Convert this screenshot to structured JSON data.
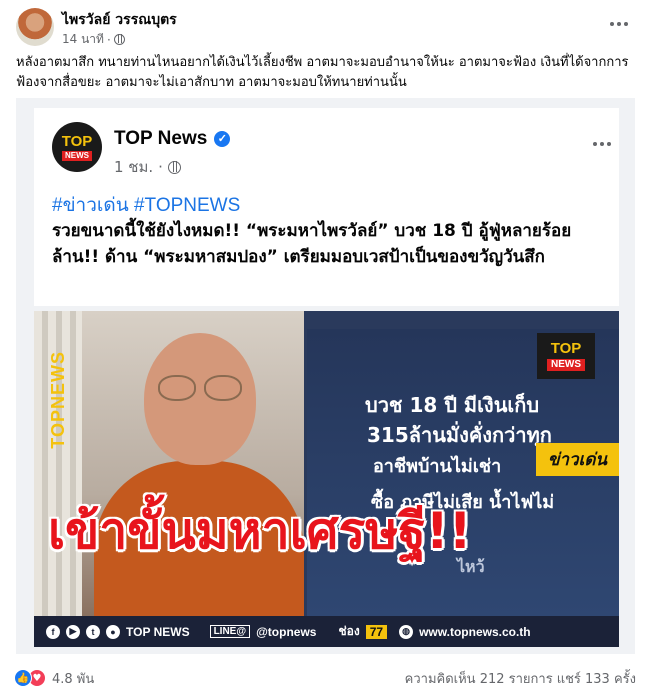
{
  "post": {
    "author": "ไพรวัลย์ วรรณบุตร",
    "time": "14 นาที",
    "dot": "·",
    "caption": "หลังอาตมาสึก ทนายท่านไหนอยากได้เงินไว้เลี้ยงชีพ อาตมาจะมอบอำนาจให้นะ อาตมาจะฟ้อง เงินที่ได้จากการฟ้องจากสื่อขยะ อาตมาจะไม่เอาสักบาท อาตมาจะมอบให้ทนายท่านนั้น"
  },
  "shared": {
    "page_name": "TOP News",
    "logo_top": "TOP",
    "logo_news": "NEWS",
    "time": "1 ชม.",
    "dot": "·",
    "tags": "#ข่าวเด่น #TOPNEWS",
    "text": "รวยขนาดนี้ใช้ยังไงหมด!! “พระมหาไพรวัลย์” บวช 18 ปี อู้ฟู่หลายร้อยล้าน!! ด้าน “พระมหาสมปอง” เตรียมมอบเวสป้าเป็นของขวัญวันสึก"
  },
  "graphic": {
    "vertical_brand": "TOPNEWS",
    "logo_top": "TOP",
    "logo_news": "NEWS",
    "line1": "บวช 18 ปี มีเงินเก็บ",
    "line2": "315ล้านมั่งคั่งกว่าทุก",
    "line3": "อาชีพบ้านไม่เช่า",
    "line4": "ซื้อ ภาษีไม่เสีย น้ำไฟไม่",
    "line5": "ไหว้",
    "badge": "ข่าวเด่น",
    "headline": "เข้าขั้นมหาเศรษฐี!!",
    "footer_brand": "TOP NEWS",
    "footer_line": "LINE@",
    "footer_handle": "@topnews",
    "footer_channel_label": "ช่อง",
    "footer_channel_num": "77",
    "footer_site": "www.topnews.co.th"
  },
  "stats": {
    "reactions": "4.8 พัน",
    "comments": "ความคิดเห็น 212 รายการ",
    "shares": "แชร์ 133 ครั้ง"
  }
}
